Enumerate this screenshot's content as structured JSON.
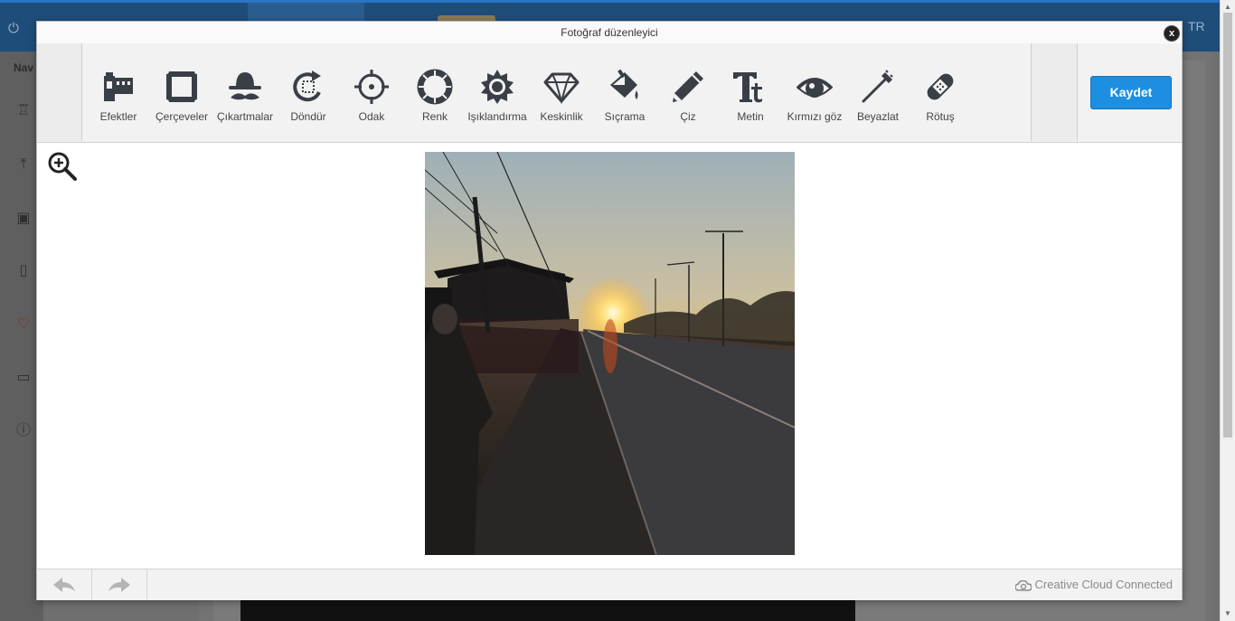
{
  "background": {
    "nav_title": "Nav",
    "language": "TR"
  },
  "editor": {
    "title": "Fotoğraf düzenleyici",
    "close_label": "x",
    "save_label": "Kaydet",
    "tools": [
      {
        "label": "Efektler",
        "icon": "effects-icon"
      },
      {
        "label": "Çerçeveler",
        "icon": "frames-icon"
      },
      {
        "label": "Çıkartmalar",
        "icon": "stickers-icon"
      },
      {
        "label": "Döndür",
        "icon": "rotate-icon"
      },
      {
        "label": "Odak",
        "icon": "focus-icon"
      },
      {
        "label": "Renk",
        "icon": "color-icon"
      },
      {
        "label": "Işıklandırma",
        "icon": "lighting-icon"
      },
      {
        "label": "Keskinlik",
        "icon": "sharpness-icon"
      },
      {
        "label": "Sıçrama",
        "icon": "splash-icon"
      },
      {
        "label": "Çiz",
        "icon": "draw-icon"
      },
      {
        "label": "Metin",
        "icon": "text-icon"
      },
      {
        "label": "Kırmızı göz",
        "icon": "red-eye-icon"
      },
      {
        "label": "Beyazlat",
        "icon": "whiten-icon"
      },
      {
        "label": "Rötuş",
        "icon": "retouch-icon"
      }
    ],
    "footer": {
      "creative_cloud": "Creative Cloud Connected"
    },
    "colors": {
      "accent": "#1e8fe0",
      "icon": "#3a3f47"
    }
  }
}
